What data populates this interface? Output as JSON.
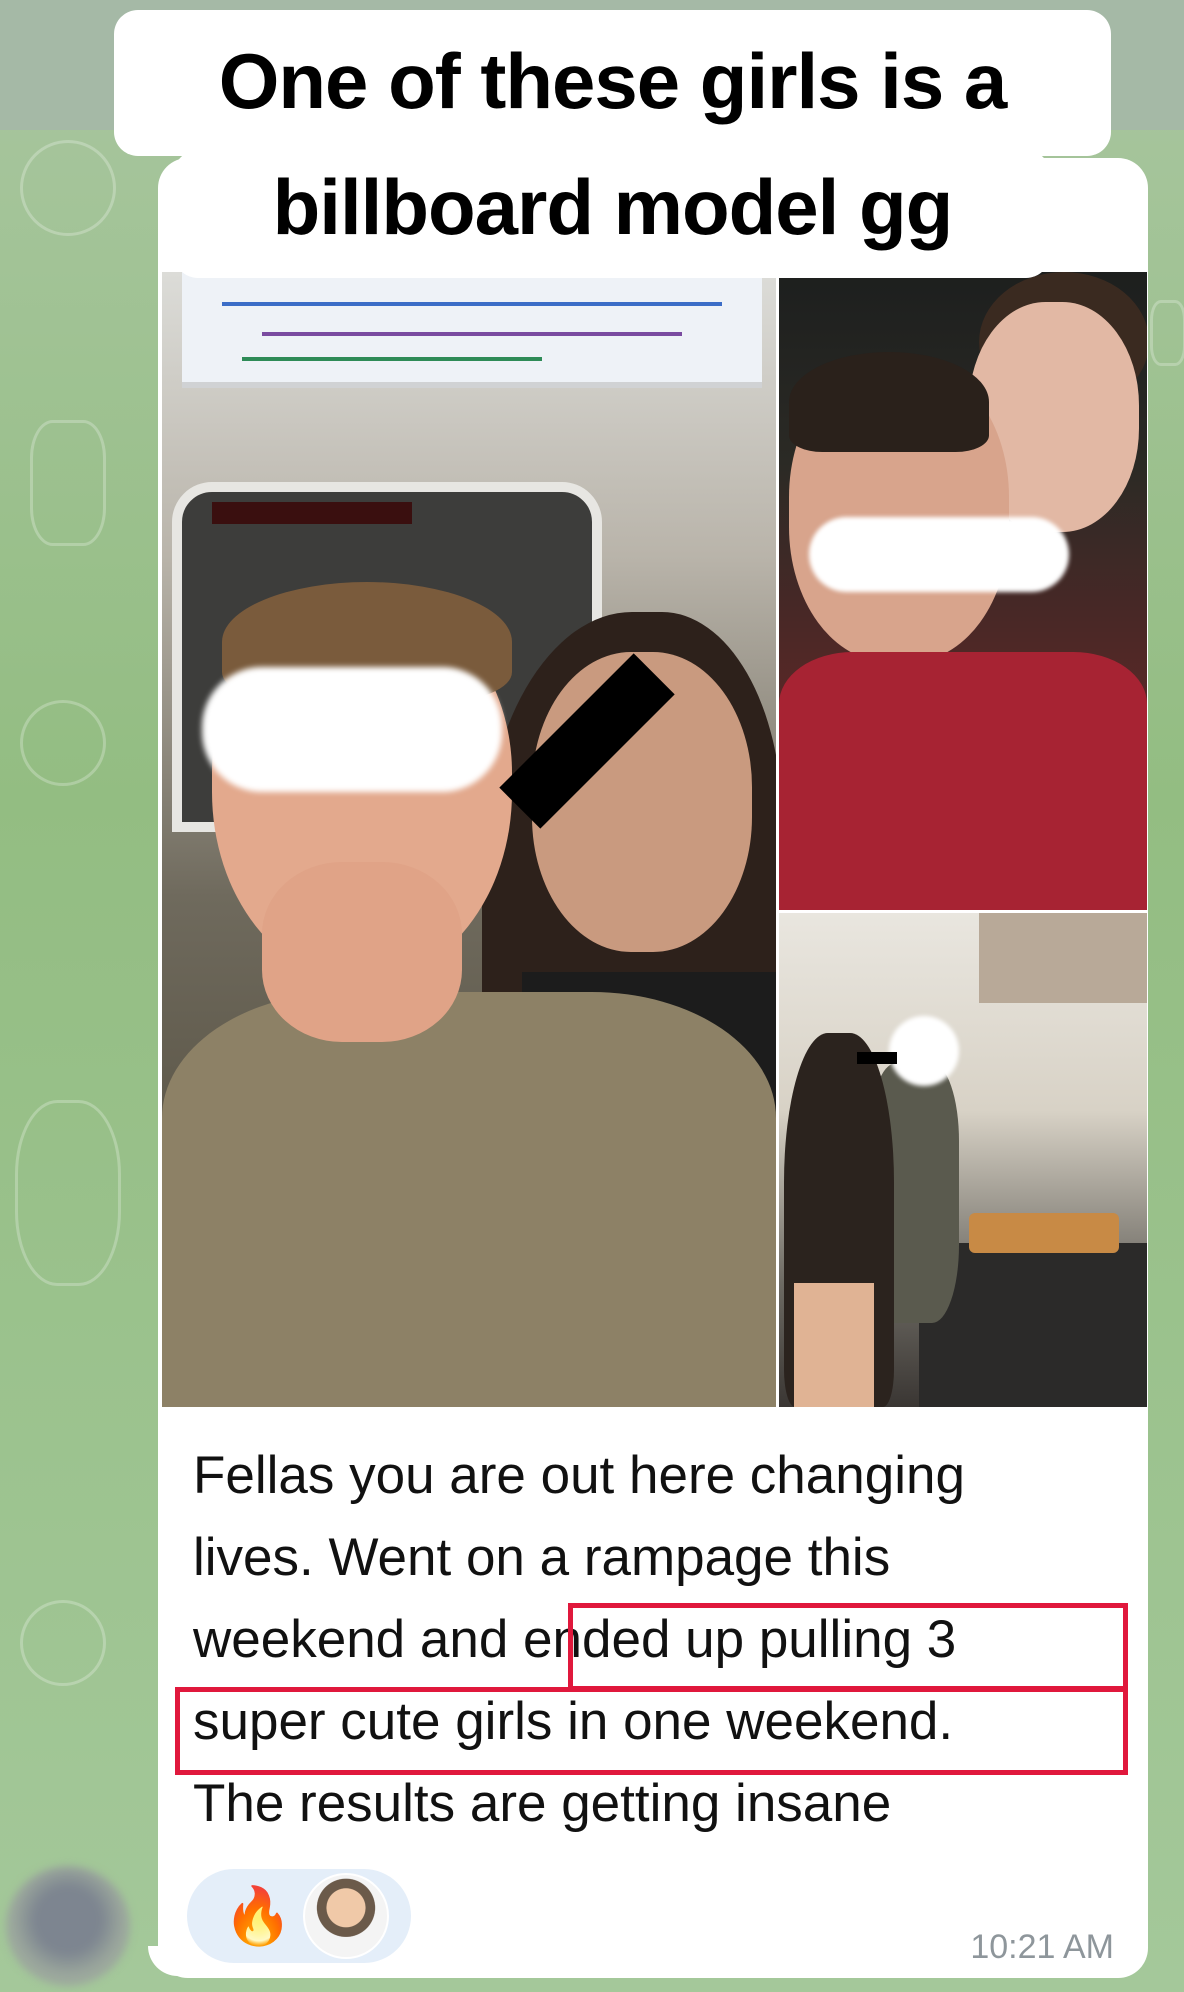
{
  "caption": {
    "line1": "One of these girls is a",
    "line2": "billboard model gg"
  },
  "message": {
    "line1": "Fellas you are out here changing",
    "line2": "lives. Went on a rampage this",
    "line3_start": "weekend and ",
    "line3_highlight": "ended up pulling 3",
    "line4_highlight": "super cute girls in one weekend.",
    "line5": "The results are getting insane",
    "timestamp": "10:21 AM"
  },
  "reactions": {
    "emoji": "🔥",
    "emoji_name": "fire-emoji",
    "reactor_avatar": "user-avatar"
  },
  "photos": [
    {
      "name": "subway-selfie-photo"
    },
    {
      "name": "night-hug-photo"
    },
    {
      "name": "kitchen-photo"
    }
  ],
  "colors": {
    "highlight": "#e0183c",
    "chat_background": "#9fc28f",
    "bubble": "#ffffff",
    "timestamp": "#8e969b"
  }
}
